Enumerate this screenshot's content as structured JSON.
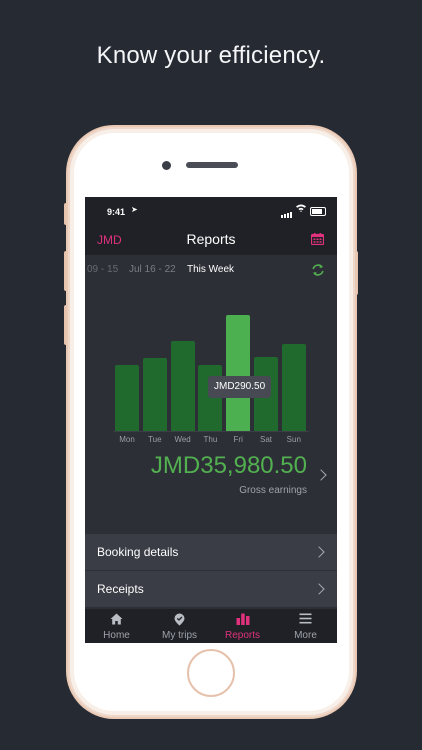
{
  "headline": "Know your efficiency.",
  "status_bar": {
    "time": "9:41"
  },
  "header": {
    "currency": "JMD",
    "title": "Reports"
  },
  "weeks": [
    "09 - 15",
    "Jul 16 - 22",
    "This Week"
  ],
  "chart_data": {
    "type": "bar",
    "categories": [
      "Mon",
      "Tue",
      "Wed",
      "Thu",
      "Fri",
      "Sat",
      "Sun"
    ],
    "values": [
      4.6,
      5.1,
      6.3,
      4.6,
      8.1,
      5.2,
      6.1
    ],
    "highlighted_index": 4,
    "tooltip": "JMD290.50",
    "colors": {
      "bar": "#1f6a2c",
      "highlight": "#4caf50"
    }
  },
  "summary": {
    "amount": "JMD35,980.50",
    "label": "Gross earnings"
  },
  "rows": [
    {
      "label": "Booking details"
    },
    {
      "label": "Receipts"
    }
  ],
  "tabs": [
    {
      "label": "Home",
      "icon": "home-icon"
    },
    {
      "label": "My trips",
      "icon": "location-icon"
    },
    {
      "label": "Reports",
      "icon": "bar-chart-icon",
      "active": true
    },
    {
      "label": "More",
      "icon": "menu-icon"
    }
  ],
  "colors": {
    "accent": "#e0317d",
    "positive": "#52b050"
  }
}
